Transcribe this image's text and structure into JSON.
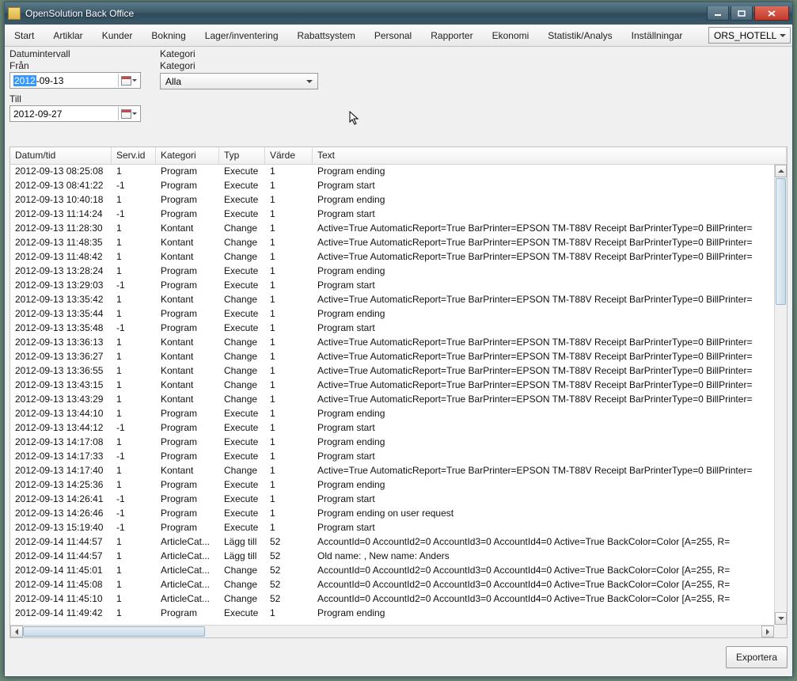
{
  "window": {
    "title": "OpenSolution Back Office"
  },
  "menubar": {
    "items": [
      "Start",
      "Artiklar",
      "Kunder",
      "Bokning",
      "Lager/inventering",
      "Rabattsystem",
      "Personal",
      "Rapporter",
      "Ekonomi",
      "Statistik/Analys",
      "Inställningar"
    ],
    "top_select": "ORS_HOTELL"
  },
  "filters": {
    "date_group_title": "Datumintervall",
    "from_label": "Från",
    "to_label": "Till",
    "from_selected": "2012",
    "from_rest": "-09-13",
    "to_value": "2012-09-27",
    "kategori_group_title": "Kategori",
    "kategori_label": "Kategori",
    "kategori_value": "Alla"
  },
  "grid": {
    "headers": [
      "Datum/tid",
      "Serv.id",
      "Kategori",
      "Typ",
      "Värde",
      "Text"
    ],
    "rows": [
      {
        "dt": "2012-09-13 08:25:08",
        "sid": "1",
        "kat": "Program",
        "typ": "Execute",
        "val": "1",
        "txt": "Program ending"
      },
      {
        "dt": "2012-09-13 08:41:22",
        "sid": "-1",
        "kat": "Program",
        "typ": "Execute",
        "val": "1",
        "txt": "Program start"
      },
      {
        "dt": "2012-09-13 10:40:18",
        "sid": "1",
        "kat": "Program",
        "typ": "Execute",
        "val": "1",
        "txt": "Program ending"
      },
      {
        "dt": "2012-09-13 11:14:24",
        "sid": "-1",
        "kat": "Program",
        "typ": "Execute",
        "val": "1",
        "txt": "Program start"
      },
      {
        "dt": "2012-09-13 11:28:30",
        "sid": "1",
        "kat": "Kontant",
        "typ": "Change",
        "val": "1",
        "txt": "Active=True  AutomaticReport=True  BarPrinter=EPSON TM-T88V Receipt  BarPrinterType=0  BillPrinter="
      },
      {
        "dt": "2012-09-13 11:48:35",
        "sid": "1",
        "kat": "Kontant",
        "typ": "Change",
        "val": "1",
        "txt": "Active=True  AutomaticReport=True  BarPrinter=EPSON TM-T88V Receipt  BarPrinterType=0  BillPrinter="
      },
      {
        "dt": "2012-09-13 11:48:42",
        "sid": "1",
        "kat": "Kontant",
        "typ": "Change",
        "val": "1",
        "txt": "Active=True  AutomaticReport=True  BarPrinter=EPSON TM-T88V Receipt  BarPrinterType=0  BillPrinter="
      },
      {
        "dt": "2012-09-13 13:28:24",
        "sid": "1",
        "kat": "Program",
        "typ": "Execute",
        "val": "1",
        "txt": "Program ending"
      },
      {
        "dt": "2012-09-13 13:29:03",
        "sid": "-1",
        "kat": "Program",
        "typ": "Execute",
        "val": "1",
        "txt": "Program start"
      },
      {
        "dt": "2012-09-13 13:35:42",
        "sid": "1",
        "kat": "Kontant",
        "typ": "Change",
        "val": "1",
        "txt": "Active=True  AutomaticReport=True  BarPrinter=EPSON TM-T88V Receipt  BarPrinterType=0  BillPrinter="
      },
      {
        "dt": "2012-09-13 13:35:44",
        "sid": "1",
        "kat": "Program",
        "typ": "Execute",
        "val": "1",
        "txt": "Program ending"
      },
      {
        "dt": "2012-09-13 13:35:48",
        "sid": "-1",
        "kat": "Program",
        "typ": "Execute",
        "val": "1",
        "txt": "Program start"
      },
      {
        "dt": "2012-09-13 13:36:13",
        "sid": "1",
        "kat": "Kontant",
        "typ": "Change",
        "val": "1",
        "txt": "Active=True  AutomaticReport=True  BarPrinter=EPSON TM-T88V Receipt  BarPrinterType=0  BillPrinter="
      },
      {
        "dt": "2012-09-13 13:36:27",
        "sid": "1",
        "kat": "Kontant",
        "typ": "Change",
        "val": "1",
        "txt": "Active=True  AutomaticReport=True  BarPrinter=EPSON TM-T88V Receipt  BarPrinterType=0  BillPrinter="
      },
      {
        "dt": "2012-09-13 13:36:55",
        "sid": "1",
        "kat": "Kontant",
        "typ": "Change",
        "val": "1",
        "txt": "Active=True  AutomaticReport=True  BarPrinter=EPSON TM-T88V Receipt  BarPrinterType=0  BillPrinter="
      },
      {
        "dt": "2012-09-13 13:43:15",
        "sid": "1",
        "kat": "Kontant",
        "typ": "Change",
        "val": "1",
        "txt": "Active=True  AutomaticReport=True  BarPrinter=EPSON TM-T88V Receipt  BarPrinterType=0  BillPrinter="
      },
      {
        "dt": "2012-09-13 13:43:29",
        "sid": "1",
        "kat": "Kontant",
        "typ": "Change",
        "val": "1",
        "txt": "Active=True  AutomaticReport=True  BarPrinter=EPSON TM-T88V Receipt  BarPrinterType=0  BillPrinter="
      },
      {
        "dt": "2012-09-13 13:44:10",
        "sid": "1",
        "kat": "Program",
        "typ": "Execute",
        "val": "1",
        "txt": "Program ending"
      },
      {
        "dt": "2012-09-13 13:44:12",
        "sid": "-1",
        "kat": "Program",
        "typ": "Execute",
        "val": "1",
        "txt": "Program start"
      },
      {
        "dt": "2012-09-13 14:17:08",
        "sid": "1",
        "kat": "Program",
        "typ": "Execute",
        "val": "1",
        "txt": "Program ending"
      },
      {
        "dt": "2012-09-13 14:17:33",
        "sid": "-1",
        "kat": "Program",
        "typ": "Execute",
        "val": "1",
        "txt": "Program start"
      },
      {
        "dt": "2012-09-13 14:17:40",
        "sid": "1",
        "kat": "Kontant",
        "typ": "Change",
        "val": "1",
        "txt": "Active=True  AutomaticReport=True  BarPrinter=EPSON TM-T88V Receipt  BarPrinterType=0  BillPrinter="
      },
      {
        "dt": "2012-09-13 14:25:36",
        "sid": "1",
        "kat": "Program",
        "typ": "Execute",
        "val": "1",
        "txt": "Program ending"
      },
      {
        "dt": "2012-09-13 14:26:41",
        "sid": "-1",
        "kat": "Program",
        "typ": "Execute",
        "val": "1",
        "txt": "Program start"
      },
      {
        "dt": "2012-09-13 14:26:46",
        "sid": "-1",
        "kat": "Program",
        "typ": "Execute",
        "val": "1",
        "txt": "Program ending on user request"
      },
      {
        "dt": "2012-09-13 15:19:40",
        "sid": "-1",
        "kat": "Program",
        "typ": "Execute",
        "val": "1",
        "txt": "Program start"
      },
      {
        "dt": "2012-09-14 11:44:57",
        "sid": "1",
        "kat": "ArticleCat...",
        "typ": "Lägg till",
        "val": "52",
        "txt": "AccountId=0  AccountId2=0  AccountId3=0  AccountId4=0  Active=True  BackColor=Color [A=255, R="
      },
      {
        "dt": "2012-09-14 11:44:57",
        "sid": "1",
        "kat": "ArticleCat...",
        "typ": "Lägg till",
        "val": "52",
        "txt": "Old name: , New name: Anders"
      },
      {
        "dt": "2012-09-14 11:45:01",
        "sid": "1",
        "kat": "ArticleCat...",
        "typ": "Change",
        "val": "52",
        "txt": "AccountId=0  AccountId2=0  AccountId3=0  AccountId4=0  Active=True  BackColor=Color [A=255, R="
      },
      {
        "dt": "2012-09-14 11:45:08",
        "sid": "1",
        "kat": "ArticleCat...",
        "typ": "Change",
        "val": "52",
        "txt": "AccountId=0  AccountId2=0  AccountId3=0  AccountId4=0  Active=True  BackColor=Color [A=255, R="
      },
      {
        "dt": "2012-09-14 11:45:10",
        "sid": "1",
        "kat": "ArticleCat...",
        "typ": "Change",
        "val": "52",
        "txt": "AccountId=0  AccountId2=0  AccountId3=0  AccountId4=0  Active=True  BackColor=Color [A=255, R="
      },
      {
        "dt": "2012-09-14 11:49:42",
        "sid": "1",
        "kat": "Program",
        "typ": "Execute",
        "val": "1",
        "txt": "Program ending"
      }
    ]
  },
  "footer": {
    "export_label": "Exportera"
  }
}
